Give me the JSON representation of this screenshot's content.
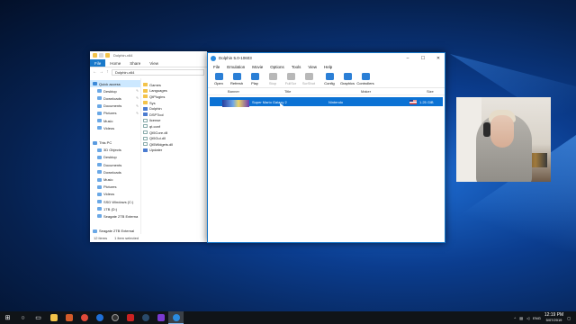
{
  "explorer": {
    "title": "Dolphin-x64",
    "tabs": [
      "File",
      "Home",
      "Share",
      "View"
    ],
    "address": "Dolphin-x64",
    "nav_items": [
      {
        "label": "Quick access",
        "selected": true,
        "pinned": false
      },
      {
        "label": "Desktop",
        "selected": false,
        "pinned": true
      },
      {
        "label": "Downloads",
        "selected": false,
        "pinned": true
      },
      {
        "label": "Documents",
        "selected": false,
        "pinned": true
      },
      {
        "label": "Pictures",
        "selected": false,
        "pinned": true
      },
      {
        "label": "Music",
        "selected": false,
        "pinned": false
      },
      {
        "label": "Videos",
        "selected": false,
        "pinned": false
      },
      {
        "label": "",
        "selected": false,
        "pinned": false
      },
      {
        "label": "This PC",
        "selected": false,
        "pinned": false
      },
      {
        "label": "3D Objects",
        "selected": false,
        "pinned": false
      },
      {
        "label": "Desktop",
        "selected": false,
        "pinned": false
      },
      {
        "label": "Documents",
        "selected": false,
        "pinned": false
      },
      {
        "label": "Downloads",
        "selected": false,
        "pinned": false
      },
      {
        "label": "Music",
        "selected": false,
        "pinned": false
      },
      {
        "label": "Pictures",
        "selected": false,
        "pinned": false
      },
      {
        "label": "Videos",
        "selected": false,
        "pinned": false
      },
      {
        "label": "SSD Windows (C:)",
        "selected": false,
        "pinned": false
      },
      {
        "label": "1TB (D:)",
        "selected": false,
        "pinned": false
      },
      {
        "label": "Seagate 2TB Externa",
        "selected": false,
        "pinned": false
      },
      {
        "label": "",
        "selected": false,
        "pinned": false
      },
      {
        "label": "Seagate 2TB External",
        "selected": false,
        "pinned": false
      },
      {
        "label": "",
        "selected": false,
        "pinned": false
      },
      {
        "label": "Network",
        "selected": false,
        "pinned": false
      }
    ],
    "files": [
      {
        "name": "Games",
        "kind": "folder"
      },
      {
        "name": "Languages",
        "kind": "folder"
      },
      {
        "name": "QtPlugins",
        "kind": "folder"
      },
      {
        "name": "Sys",
        "kind": "folder"
      },
      {
        "name": "Dolphin",
        "kind": "exe"
      },
      {
        "name": "DSPTool",
        "kind": "exe"
      },
      {
        "name": "license",
        "kind": "doc"
      },
      {
        "name": "qt.conf",
        "kind": "doc"
      },
      {
        "name": "Qt5Core.dll",
        "kind": "doc"
      },
      {
        "name": "Qt5Gui.dll",
        "kind": "doc"
      },
      {
        "name": "Qt5Widgets.dll",
        "kind": "doc"
      },
      {
        "name": "Updater",
        "kind": "exe"
      }
    ],
    "status_items": "12 items",
    "status_selected": "1 item selected"
  },
  "dolphin": {
    "title": "Dolphin 5.0-10603",
    "menu": [
      "File",
      "Emulation",
      "Movie",
      "Options",
      "Tools",
      "View",
      "Help"
    ],
    "toolbar": [
      {
        "label": "Open",
        "icon": "open-icon",
        "color": "#2b7fd6",
        "enabled": true
      },
      {
        "label": "Refresh",
        "icon": "refresh-icon",
        "color": "#2b7fd6",
        "enabled": true
      },
      {
        "label": "Play",
        "icon": "play-icon",
        "color": "#2b7fd6",
        "enabled": true
      },
      {
        "label": "Stop",
        "icon": "stop-icon",
        "color": "#2b7fd6",
        "enabled": false
      },
      {
        "label": "FullScr",
        "icon": "fullscreen-icon",
        "color": "#2b7fd6",
        "enabled": false
      },
      {
        "label": "ScrShot",
        "icon": "screenshot-icon",
        "color": "#2b7fd6",
        "enabled": false
      },
      {
        "label": "Config",
        "icon": "config-icon",
        "color": "#2b7fd6",
        "enabled": true
      },
      {
        "label": "Graphics",
        "icon": "graphics-icon",
        "color": "#2b7fd6",
        "enabled": true
      },
      {
        "label": "Controllers",
        "icon": "controllers-icon",
        "color": "#2b7fd6",
        "enabled": true
      }
    ],
    "columns": {
      "banner": "Banner",
      "title": "Title",
      "maker": "Maker",
      "size": "Size"
    },
    "games": [
      {
        "title": "Super Mario Galaxy 2",
        "maker": "Nintendo",
        "size": "1.25 GiB",
        "selected": true
      }
    ],
    "selection_color": "#0b72d4"
  },
  "taskbar": {
    "time": "12:19 PM",
    "date": "5/07/2019",
    "language": "ENG",
    "apps": [
      "start",
      "search",
      "task-view",
      "explorer",
      "app",
      "chrome",
      "browser",
      "obs",
      "media",
      "steam",
      "app",
      "dolphin"
    ]
  }
}
